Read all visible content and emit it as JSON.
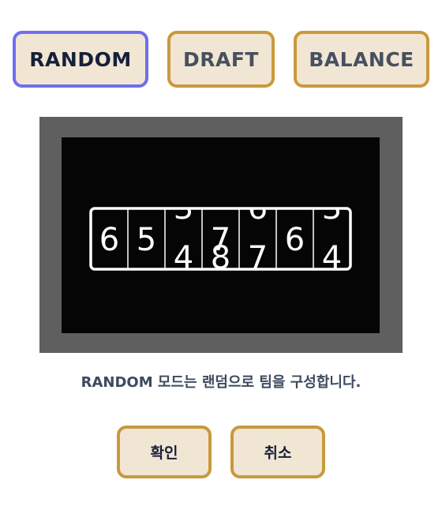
{
  "mode_buttons": [
    {
      "label": "RANDOM",
      "selected": true
    },
    {
      "label": "DRAFT",
      "selected": false
    },
    {
      "label": "BALANCE",
      "selected": false
    }
  ],
  "preview": {
    "slot_digits": [
      {
        "partial_top": "",
        "main": "6",
        "partial_bottom": ""
      },
      {
        "partial_top": "",
        "main": "5",
        "partial_bottom": ""
      },
      {
        "partial_top": "3",
        "main": "",
        "partial_bottom": "4"
      },
      {
        "partial_top": "",
        "main": "7",
        "partial_bottom": "8"
      },
      {
        "partial_top": "6",
        "main": "",
        "partial_bottom": "7"
      },
      {
        "partial_top": "",
        "main": "6",
        "partial_bottom": ""
      },
      {
        "partial_top": "3",
        "main": "",
        "partial_bottom": "4"
      }
    ]
  },
  "description": "RANDOM 모드는 랜덤으로 팀을 구성합니다.",
  "actions": {
    "confirm_label": "확인",
    "cancel_label": "취소"
  },
  "colors": {
    "button_bg": "#f1e6d4",
    "button_border": "#c9993c",
    "selected_border": "#6e6ef0",
    "frame_bg": "#5f5f5f",
    "screen_bg": "#050505"
  }
}
